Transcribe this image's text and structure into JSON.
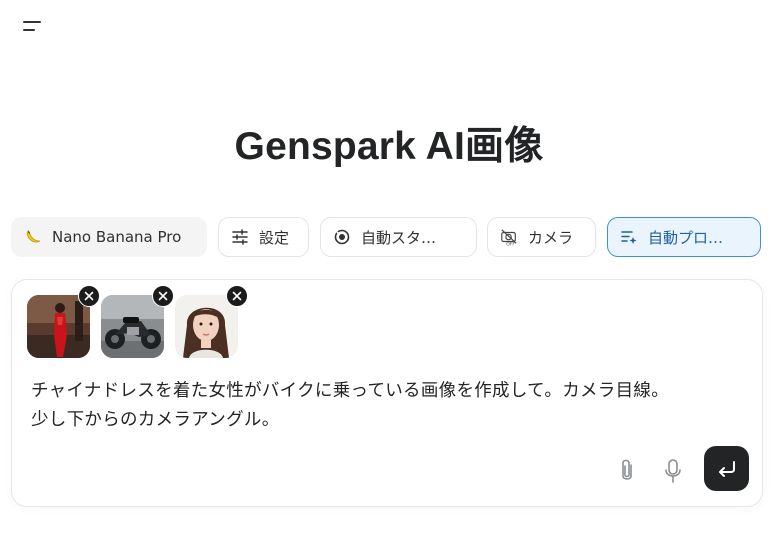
{
  "header": {
    "menu_icon": "hamburger-menu-icon"
  },
  "page": {
    "title": "Genspark AI画像"
  },
  "options": {
    "model": {
      "icon": "banana-icon",
      "label": "Nano Banana Pro"
    },
    "settings": {
      "icon": "sliders-icon",
      "label": "設定"
    },
    "style": {
      "icon": "auto-style-icon",
      "label": "自動スタ…"
    },
    "camera": {
      "icon": "camera-off-icon",
      "label": "カメラ"
    },
    "auto_prompt": {
      "icon": "auto-prompt-icon",
      "label": "自動プロ…",
      "active": true
    }
  },
  "composer": {
    "attachments": [
      {
        "name": "woman-in-red-qipao"
      },
      {
        "name": "motorcycle"
      },
      {
        "name": "woman-portrait"
      }
    ],
    "prompt_lines": [
      "チャイナドレスを着た女性がバイクに乗っている画像を作成して。カメラ目線。",
      "少し下からのカメラアングル。"
    ],
    "icons": {
      "attach": "paperclip-icon",
      "mic": "microphone-icon",
      "send": "enter-arrow-icon"
    }
  },
  "colors": {
    "accent": "#3c8fe0",
    "accent_bg": "#eaf4fd",
    "send_bg": "#232425"
  }
}
